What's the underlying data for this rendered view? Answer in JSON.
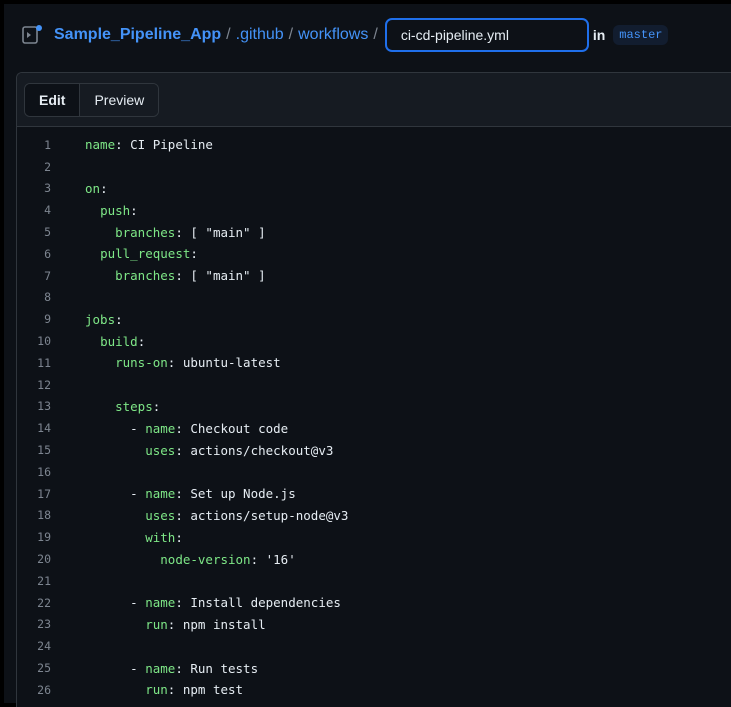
{
  "breadcrumb": {
    "repo": "Sample_Pipeline_App",
    "sep": "/",
    "folder1": ".github",
    "folder2": "workflows",
    "filename": "ci-cd-pipeline.yml",
    "in_label": "in",
    "branch": "master"
  },
  "tabs": {
    "edit": "Edit",
    "preview": "Preview"
  },
  "code_lines": [
    {
      "n": "1",
      "parts": [
        {
          "c": "k",
          "t": "name"
        },
        {
          "c": "p",
          "t": ": CI Pipeline"
        }
      ]
    },
    {
      "n": "2",
      "parts": []
    },
    {
      "n": "3",
      "parts": [
        {
          "c": "k",
          "t": "on"
        },
        {
          "c": "p",
          "t": ":"
        }
      ]
    },
    {
      "n": "4",
      "parts": [
        {
          "c": "p",
          "t": "  "
        },
        {
          "c": "k",
          "t": "push"
        },
        {
          "c": "p",
          "t": ":"
        }
      ]
    },
    {
      "n": "5",
      "parts": [
        {
          "c": "p",
          "t": "    "
        },
        {
          "c": "k",
          "t": "branches"
        },
        {
          "c": "p",
          "t": ": [ \"main\" ]"
        }
      ]
    },
    {
      "n": "6",
      "parts": [
        {
          "c": "p",
          "t": "  "
        },
        {
          "c": "k",
          "t": "pull_request"
        },
        {
          "c": "p",
          "t": ":"
        }
      ]
    },
    {
      "n": "7",
      "parts": [
        {
          "c": "p",
          "t": "    "
        },
        {
          "c": "k",
          "t": "branches"
        },
        {
          "c": "p",
          "t": ": [ \"main\" ]"
        }
      ]
    },
    {
      "n": "8",
      "parts": []
    },
    {
      "n": "9",
      "parts": [
        {
          "c": "k",
          "t": "jobs"
        },
        {
          "c": "p",
          "t": ":"
        }
      ]
    },
    {
      "n": "10",
      "parts": [
        {
          "c": "p",
          "t": "  "
        },
        {
          "c": "k",
          "t": "build"
        },
        {
          "c": "p",
          "t": ":"
        }
      ]
    },
    {
      "n": "11",
      "parts": [
        {
          "c": "p",
          "t": "    "
        },
        {
          "c": "k",
          "t": "runs-on"
        },
        {
          "c": "p",
          "t": ": ubuntu-latest"
        }
      ]
    },
    {
      "n": "12",
      "parts": []
    },
    {
      "n": "13",
      "parts": [
        {
          "c": "p",
          "t": "    "
        },
        {
          "c": "k",
          "t": "steps"
        },
        {
          "c": "p",
          "t": ":"
        }
      ]
    },
    {
      "n": "14",
      "parts": [
        {
          "c": "p",
          "t": "      - "
        },
        {
          "c": "k",
          "t": "name"
        },
        {
          "c": "p",
          "t": ": Checkout code"
        }
      ]
    },
    {
      "n": "15",
      "parts": [
        {
          "c": "p",
          "t": "        "
        },
        {
          "c": "k",
          "t": "uses"
        },
        {
          "c": "p",
          "t": ": actions/checkout@v3"
        }
      ]
    },
    {
      "n": "16",
      "parts": []
    },
    {
      "n": "17",
      "parts": [
        {
          "c": "p",
          "t": "      - "
        },
        {
          "c": "k",
          "t": "name"
        },
        {
          "c": "p",
          "t": ": Set up Node.js"
        }
      ]
    },
    {
      "n": "18",
      "parts": [
        {
          "c": "p",
          "t": "        "
        },
        {
          "c": "k",
          "t": "uses"
        },
        {
          "c": "p",
          "t": ": actions/setup-node@v3"
        }
      ]
    },
    {
      "n": "19",
      "parts": [
        {
          "c": "p",
          "t": "        "
        },
        {
          "c": "k",
          "t": "with"
        },
        {
          "c": "p",
          "t": ":"
        }
      ]
    },
    {
      "n": "20",
      "parts": [
        {
          "c": "p",
          "t": "          "
        },
        {
          "c": "k",
          "t": "node-version"
        },
        {
          "c": "p",
          "t": ": '16'"
        }
      ]
    },
    {
      "n": "21",
      "parts": []
    },
    {
      "n": "22",
      "parts": [
        {
          "c": "p",
          "t": "      - "
        },
        {
          "c": "k",
          "t": "name"
        },
        {
          "c": "p",
          "t": ": Install dependencies"
        }
      ]
    },
    {
      "n": "23",
      "parts": [
        {
          "c": "p",
          "t": "        "
        },
        {
          "c": "k",
          "t": "run"
        },
        {
          "c": "p",
          "t": ": npm install"
        }
      ]
    },
    {
      "n": "24",
      "parts": []
    },
    {
      "n": "25",
      "parts": [
        {
          "c": "p",
          "t": "      - "
        },
        {
          "c": "k",
          "t": "name"
        },
        {
          "c": "p",
          "t": ": Run tests"
        }
      ]
    },
    {
      "n": "26",
      "parts": [
        {
          "c": "p",
          "t": "        "
        },
        {
          "c": "k",
          "t": "run"
        },
        {
          "c": "p",
          "t": ": npm test"
        }
      ]
    }
  ],
  "icons": {
    "repo": "repo-template-icon"
  }
}
